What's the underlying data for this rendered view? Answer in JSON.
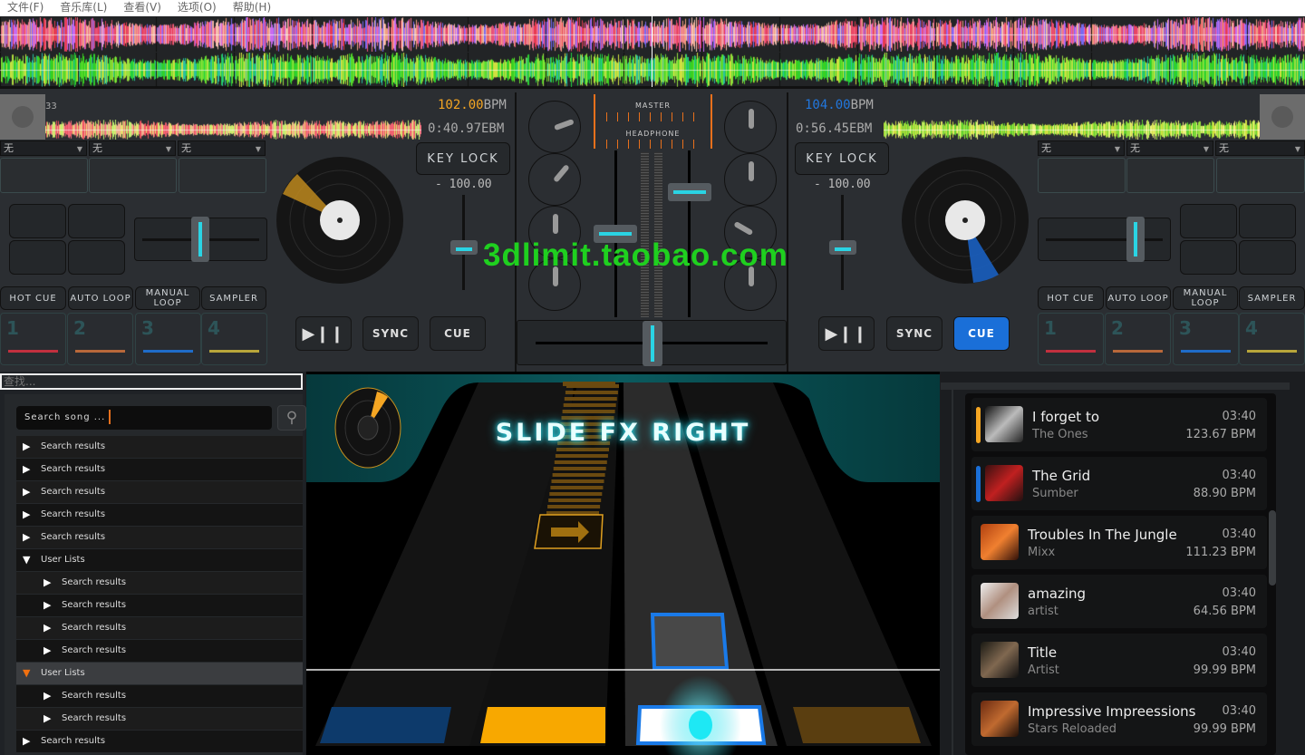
{
  "menu": [
    "文件(F)",
    "音乐库(L)",
    "查看(V)",
    "选项(O)",
    "帮助(H)"
  ],
  "colors": {
    "accent_orange": "#f5a623",
    "accent_blue": "#1a6fd8",
    "cyan": "#2ad4e4",
    "watermark": "#1fd01f"
  },
  "left_deck": {
    "counter": "33",
    "bpm_value": "102.00",
    "bpm_unit": "BPM",
    "time": "0:40.97EBM",
    "key_lock": "KEY LOCK",
    "pitch": "- 100.00",
    "dropdowns": [
      "无",
      "无",
      "无"
    ],
    "modes": [
      "HOT CUE",
      "AUTO LOOP",
      "MANUAL LOOP",
      "SAMPLER"
    ],
    "pads": [
      "1",
      "2",
      "3",
      "4"
    ],
    "play_icon": "play-pause-icon",
    "sync": "SYNC",
    "cue": "CUE"
  },
  "right_deck": {
    "bpm_value": "104.00",
    "bpm_unit": "BPM",
    "time": "0:56.45EBM",
    "key_lock": "KEY LOCK",
    "pitch": "- 100.00",
    "dropdowns": [
      "无",
      "无",
      "无"
    ],
    "modes": [
      "HOT CUE",
      "AUTO LOOP",
      "MANUAL LOOP",
      "SAMPLER"
    ],
    "pads": [
      "1",
      "2",
      "3",
      "4"
    ],
    "sync": "SYNC",
    "cue": "CUE"
  },
  "mixer": {
    "master": "MASTER",
    "headphone": "HEADPHONE"
  },
  "watermark": "3dlimit.taobao.com",
  "library": {
    "filter_placeholder": "查找...",
    "search_placeholder": "Search song ...",
    "tree": [
      {
        "label": "Search results",
        "level": 0,
        "open": false
      },
      {
        "label": "Search results",
        "level": 0,
        "open": false
      },
      {
        "label": "Search results",
        "level": 0,
        "open": false
      },
      {
        "label": "Search results",
        "level": 0,
        "open": false
      },
      {
        "label": "Search results",
        "level": 0,
        "open": false
      },
      {
        "label": "User Lists",
        "level": 0,
        "open": true
      },
      {
        "label": "Search results",
        "level": 1,
        "open": false
      },
      {
        "label": "Search results",
        "level": 1,
        "open": false
      },
      {
        "label": "Search results",
        "level": 1,
        "open": false
      },
      {
        "label": "Search results",
        "level": 1,
        "open": false
      },
      {
        "label": "User Lists",
        "level": 0,
        "open": true,
        "selected": true
      },
      {
        "label": "Search results",
        "level": 1,
        "open": false
      },
      {
        "label": "Search results",
        "level": 1,
        "open": false
      },
      {
        "label": "Search results",
        "level": 0,
        "open": false
      }
    ]
  },
  "game": {
    "instruction": "SLIDE FX RIGHT"
  },
  "playlist": [
    {
      "title": "I forget to",
      "artist": "The Ones",
      "duration": "03:40",
      "bpm": "123.67 BPM",
      "marker": "#f5a623"
    },
    {
      "title": "The Grid",
      "artist": "Sumber",
      "duration": "03:40",
      "bpm": "88.90 BPM",
      "marker": "#1a6fd8"
    },
    {
      "title": "Troubles In The Jungle",
      "artist": "Mixx",
      "duration": "03:40",
      "bpm": "111.23 BPM"
    },
    {
      "title": "amazing",
      "artist": "artist",
      "duration": "03:40",
      "bpm": "64.56 BPM"
    },
    {
      "title": "Title",
      "artist": "Artist",
      "duration": "03:40",
      "bpm": "99.99 BPM"
    },
    {
      "title": "Impressive Impreessions",
      "artist": "Stars Reloaded",
      "duration": "03:40",
      "bpm": "99.99 BPM"
    }
  ]
}
